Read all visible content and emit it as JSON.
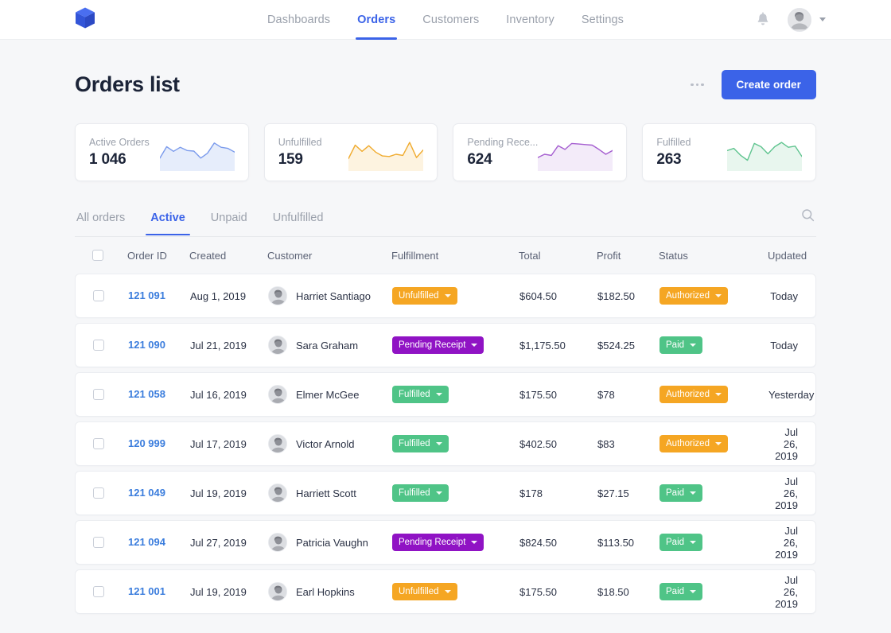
{
  "brand": {
    "logo_icon": "cube-logo-icon"
  },
  "nav": {
    "items": [
      {
        "label": "Dashboards",
        "active": false
      },
      {
        "label": "Orders",
        "active": true
      },
      {
        "label": "Customers",
        "active": false
      },
      {
        "label": "Inventory",
        "active": false
      },
      {
        "label": "Settings",
        "active": false
      }
    ],
    "bell_icon": "notification-bell-icon",
    "avatar_icon": "user-avatar",
    "caret_icon": "chevron-down-icon"
  },
  "header": {
    "title": "Orders list",
    "more_icon": "more-options-icon",
    "create_label": "Create order"
  },
  "cards": [
    {
      "label": "Active Orders",
      "value": "1 046",
      "color": "#7b9bec",
      "fill": "#e6edfb"
    },
    {
      "label": "Unfulfilled",
      "value": "159",
      "color": "#f0ab2e",
      "fill": "#fdf3e0"
    },
    {
      "label": "Pending Rece...",
      "value": "624",
      "color": "#a55ed0",
      "fill": "#f3ebf9"
    },
    {
      "label": "Fulfilled",
      "value": "263",
      "color": "#5fc48f",
      "fill": "#e8f6ee"
    }
  ],
  "tabs": [
    {
      "label": "All orders",
      "active": false
    },
    {
      "label": "Active",
      "active": true
    },
    {
      "label": "Unpaid",
      "active": false
    },
    {
      "label": "Unfulfilled",
      "active": false
    }
  ],
  "search": {
    "icon": "search-icon"
  },
  "table": {
    "columns": [
      "Order ID",
      "Created",
      "Customer",
      "Fulfillment",
      "Total",
      "Profit",
      "Status",
      "Updated"
    ],
    "rows": [
      {
        "id": "121 091",
        "created": "Aug 1, 2019",
        "customer": "Harriet Santiago",
        "fulfillment": "Unfulfilled",
        "fulfillment_color": "orange",
        "total": "$604.50",
        "profit": "$182.50",
        "status": "Authorized",
        "status_color": "orange",
        "updated": "Today"
      },
      {
        "id": "121 090",
        "created": "Jul 21, 2019",
        "customer": "Sara Graham",
        "fulfillment": "Pending Receipt",
        "fulfillment_color": "purple",
        "total": "$1,175.50",
        "profit": "$524.25",
        "status": "Paid",
        "status_color": "green",
        "updated": "Today"
      },
      {
        "id": "121 058",
        "created": "Jul 16, 2019",
        "customer": "Elmer McGee",
        "fulfillment": "Fulfilled",
        "fulfillment_color": "green",
        "total": "$175.50",
        "profit": "$78",
        "status": "Authorized",
        "status_color": "orange",
        "updated": "Yesterday"
      },
      {
        "id": "120 999",
        "created": "Jul 17, 2019",
        "customer": "Victor Arnold",
        "fulfillment": "Fulfilled",
        "fulfillment_color": "green",
        "total": "$402.50",
        "profit": "$83",
        "status": "Authorized",
        "status_color": "orange",
        "updated": "Jul 26, 2019"
      },
      {
        "id": "121 049",
        "created": "Jul 19, 2019",
        "customer": "Harriett Scott",
        "fulfillment": "Fulfilled",
        "fulfillment_color": "green",
        "total": "$178",
        "profit": "$27.15",
        "status": "Paid",
        "status_color": "green",
        "updated": "Jul 26, 2019"
      },
      {
        "id": "121 094",
        "created": "Jul 27, 2019",
        "customer": "Patricia Vaughn",
        "fulfillment": "Pending Receipt",
        "fulfillment_color": "purple",
        "total": "$824.50",
        "profit": "$113.50",
        "status": "Paid",
        "status_color": "green",
        "updated": "Jul 26, 2019"
      },
      {
        "id": "121 001",
        "created": "Jul 19, 2019",
        "customer": "Earl Hopkins",
        "fulfillment": "Unfulfilled",
        "fulfillment_color": "orange",
        "total": "$175.50",
        "profit": "$18.50",
        "status": "Paid",
        "status_color": "green",
        "updated": "Jul 26, 2019"
      }
    ]
  },
  "chart_data": [
    {
      "type": "area",
      "title": "Active Orders",
      "x": [
        0,
        1,
        2,
        3,
        4,
        5,
        6,
        7,
        8,
        9,
        10,
        11
      ],
      "values": [
        30,
        72,
        55,
        70,
        58,
        56,
        30,
        48,
        86,
        70,
        66,
        52
      ],
      "ylim": [
        0,
        100
      ],
      "grid": false
    },
    {
      "type": "area",
      "title": "Unfulfilled",
      "x": [
        0,
        1,
        2,
        3,
        4,
        5,
        6,
        7,
        8,
        9,
        10,
        11
      ],
      "values": [
        28,
        78,
        55,
        76,
        52,
        38,
        36,
        44,
        40,
        88,
        32,
        60
      ],
      "ylim": [
        0,
        100
      ],
      "grid": false
    },
    {
      "type": "area",
      "title": "Pending Rece...",
      "x": [
        0,
        1,
        2,
        3,
        4,
        5,
        6,
        7,
        8,
        9,
        10,
        11
      ],
      "values": [
        32,
        44,
        40,
        76,
        62,
        84,
        82,
        80,
        78,
        62,
        44,
        58
      ],
      "ylim": [
        0,
        100
      ],
      "grid": false
    },
    {
      "type": "area",
      "title": "Fulfilled",
      "x": [
        0,
        1,
        2,
        3,
        4,
        5,
        6,
        7,
        8,
        9,
        10,
        11
      ],
      "values": [
        58,
        66,
        40,
        22,
        84,
        72,
        46,
        72,
        88,
        70,
        74,
        36
      ],
      "ylim": [
        0,
        100
      ],
      "grid": false
    }
  ]
}
